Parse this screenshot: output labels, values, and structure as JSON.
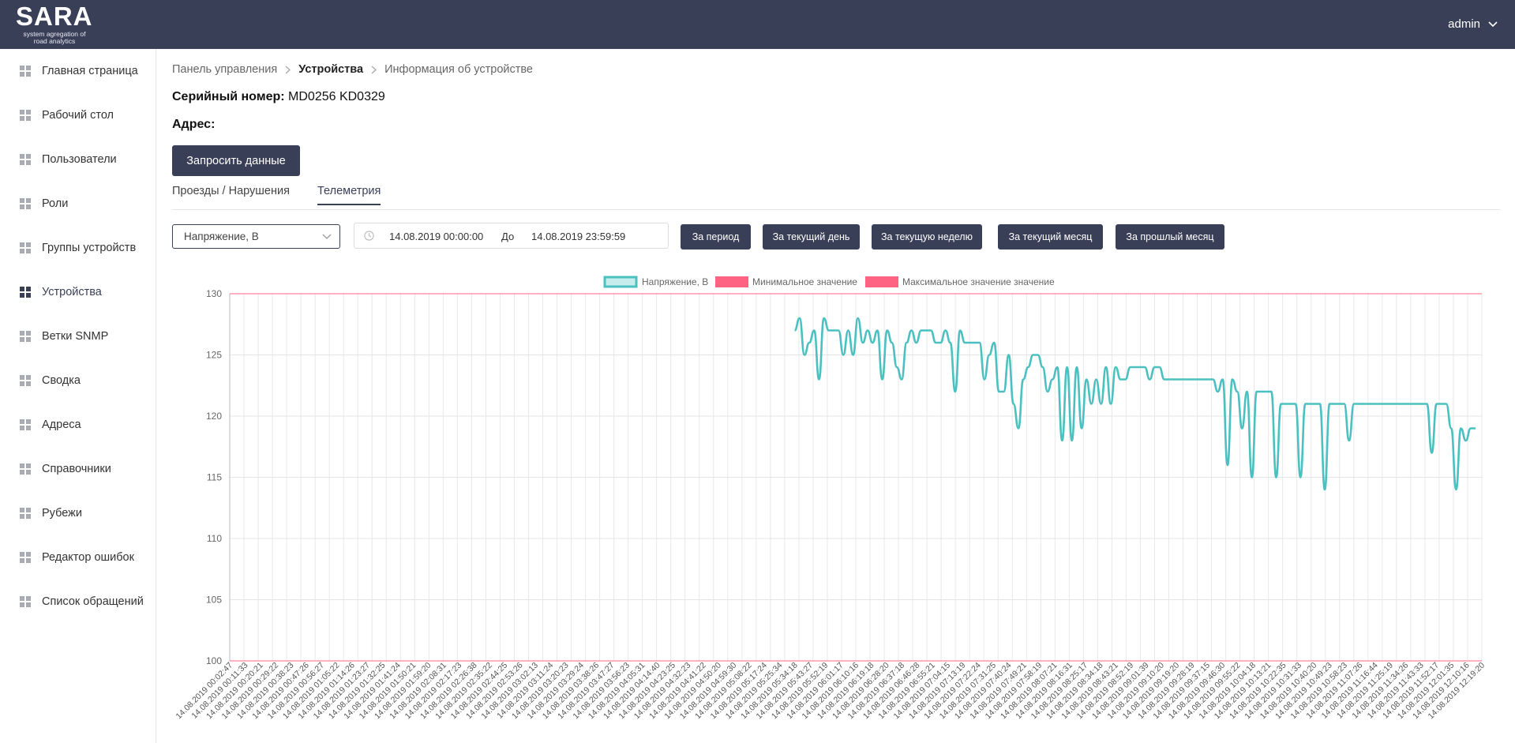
{
  "app": {
    "name": "SARA",
    "subtitle": "system agregation of road analytics",
    "user": "admin"
  },
  "sidebar": {
    "items": [
      {
        "label": "Главная страница"
      },
      {
        "label": "Рабочий стол"
      },
      {
        "label": "Пользователи"
      },
      {
        "label": "Роли"
      },
      {
        "label": "Группы устройств"
      },
      {
        "label": "Устройства"
      },
      {
        "label": "Ветки SNMP"
      },
      {
        "label": "Сводка"
      },
      {
        "label": "Адреса"
      },
      {
        "label": "Справочники"
      },
      {
        "label": "Рубежи"
      },
      {
        "label": "Редактор ошибок"
      },
      {
        "label": "Список обращений"
      }
    ]
  },
  "breadcrumb": {
    "home": "Панель управления",
    "section": "Устройства",
    "page": "Информация об устройстве"
  },
  "device": {
    "serial_label": "Серийный номер:",
    "serial_value": "MD0256 KD0329",
    "address_label": "Адрес:"
  },
  "actions": {
    "request_data": "Запросить данные"
  },
  "tabs": [
    {
      "label": "Проезды / Нарушения"
    },
    {
      "label": "Телеметрия"
    }
  ],
  "filters": {
    "metric": "Напряжение, В",
    "date_from": "14.08.2019 00:00:00",
    "to_label": "До",
    "date_to": "14.08.2019 23:59:59",
    "period_buttons": [
      "За период",
      "За текущий день",
      "За текущую неделю",
      "За текущий месяц",
      "За прошлый месяц"
    ]
  },
  "colors": {
    "accent": "#3a3f58",
    "series": "#4bc0c0",
    "limit": "#ff6384"
  },
  "chart_data": {
    "type": "line",
    "ylim": [
      100,
      130
    ],
    "yticks": [
      100,
      105,
      110,
      115,
      120,
      125,
      130
    ],
    "legend": [
      {
        "label": "Напряжение, В",
        "color": "#4bc0c0"
      },
      {
        "label": "Минимальное значение",
        "color": "#ff6384"
      },
      {
        "label": "Максимальное значение значение",
        "color": "#ff6384"
      }
    ],
    "limits": {
      "min": 100,
      "max": 130
    },
    "categories": [
      "14.08.2019 00:02:47",
      "14.08.2019 00:11:33",
      "14.08.2019 00:20:21",
      "14.08.2019 00:29:22",
      "14.08.2019 00:38:23",
      "14.08.2019 00:47:26",
      "14.08.2019 00:56:27",
      "14.08.2019 01:05:22",
      "14.08.2019 01:14:26",
      "14.08.2019 01:23:27",
      "14.08.2019 01:32:25",
      "14.08.2019 01:41:24",
      "14.08.2019 01:50:21",
      "14.08.2019 01:59:20",
      "14.08.2019 02:08:31",
      "14.08.2019 02:17:23",
      "14.08.2019 02:26:38",
      "14.08.2019 02:35:22",
      "14.08.2019 02:44:25",
      "14.08.2019 02:53:26",
      "14.08.2019 03:02:13",
      "14.08.2019 03:11:24",
      "14.08.2019 03:20:23",
      "14.08.2019 03:29:24",
      "14.08.2019 03:38:26",
      "14.08.2019 03:47:27",
      "14.08.2019 03:56:23",
      "14.08.2019 04:05:31",
      "14.08.2019 04:14:40",
      "14.08.2019 04:23:25",
      "14.08.2019 04:32:23",
      "14.08.2019 04:41:22",
      "14.08.2019 04:50:20",
      "14.08.2019 04:59:30",
      "14.08.2019 05:08:22",
      "14.08.2019 05:17:24",
      "14.08.2019 05:25:34",
      "14.08.2019 05:34:18",
      "14.08.2019 05:43:27",
      "14.08.2019 05:52:19",
      "14.08.2019 06:01:17",
      "14.08.2019 06:10:16",
      "14.08.2019 06:19:18",
      "14.08.2019 06:28:20",
      "14.08.2019 06:37:18",
      "14.08.2019 06:46:28",
      "14.08.2019 06:55:21",
      "14.08.2019 07:04:15",
      "14.08.2019 07:13:19",
      "14.08.2019 07:22:24",
      "14.08.2019 07:31:25",
      "14.08.2019 07:40:24",
      "14.08.2019 07:49:21",
      "14.08.2019 07:58:19",
      "14.08.2019 08:07:21",
      "14.08.2019 08:16:31",
      "14.08.2019 08:25:17",
      "14.08.2019 08:34:18",
      "14.08.2019 08:43:21",
      "14.08.2019 08:52:19",
      "14.08.2019 09:01:39",
      "14.08.2019 09:10:20",
      "14.08.2019 09:19:20",
      "14.08.2019 09:28:19",
      "14.08.2019 09:37:15",
      "14.08.2019 09:46:30",
      "14.08.2019 09:55:22",
      "14.08.2019 10:04:18",
      "14.08.2019 10:13:21",
      "14.08.2019 10:22:35",
      "14.08.2019 10:31:33",
      "14.08.2019 10:40:20",
      "14.08.2019 10:49:23",
      "14.08.2019 10:58:23",
      "14.08.2019 11:07:26",
      "14.08.2019 11:16:44",
      "14.08.2019 11:25:19",
      "14.08.2019 11:34:26",
      "14.08.2019 11:43:33",
      "14.08.2019 11:52:17",
      "14.08.2019 12:01:35",
      "14.08.2019 12:10:16",
      "14.08.2019 12:19:20"
    ],
    "series": [
      {
        "name": "Напряжение, В",
        "start_category": "14.08.2019 05:34:18",
        "values": [
          127,
          128,
          125,
          126,
          127,
          123,
          128,
          127,
          127,
          127,
          125,
          127,
          125,
          128,
          126,
          127,
          126,
          127,
          123,
          127,
          126,
          124,
          123,
          126,
          127,
          126,
          127,
          127,
          127,
          126,
          126,
          127,
          126,
          122,
          127,
          126,
          126,
          126,
          126,
          123,
          125,
          126,
          122,
          122,
          125,
          121,
          119,
          123,
          124,
          125,
          125,
          124,
          122,
          123,
          124,
          118,
          124,
          118,
          124,
          119,
          123,
          121,
          123,
          121,
          124,
          121,
          124,
          123,
          123,
          124,
          124,
          124,
          124,
          123,
          124,
          124,
          123,
          123,
          123,
          123,
          123,
          123,
          123,
          123,
          123,
          123,
          123,
          122,
          123,
          116,
          123,
          122,
          119,
          122,
          115,
          122,
          122,
          122,
          122,
          115,
          121,
          121,
          121,
          121,
          115,
          121,
          121,
          121,
          121,
          114,
          121,
          121,
          121,
          121,
          118,
          121,
          121,
          121,
          121,
          121,
          121,
          121,
          121,
          121,
          121,
          121,
          121,
          121,
          121,
          121,
          121,
          117,
          121,
          121,
          121,
          119,
          114,
          119,
          118,
          119,
          119
        ]
      }
    ]
  }
}
